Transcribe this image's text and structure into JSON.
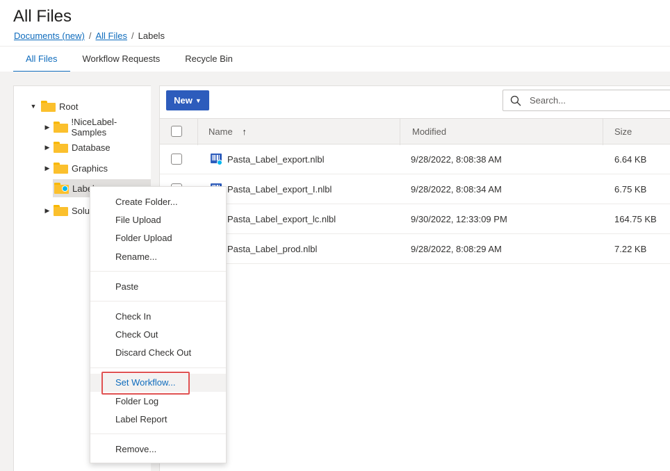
{
  "header": {
    "title": "All Files"
  },
  "breadcrumb": {
    "item1": "Documents (new)",
    "item2": "All Files",
    "current": "Labels",
    "separator": "/"
  },
  "tabs": [
    {
      "label": "All Files",
      "active": true
    },
    {
      "label": "Workflow Requests",
      "active": false
    },
    {
      "label": "Recycle Bin",
      "active": false
    }
  ],
  "tree": {
    "root": "Root",
    "items": [
      "!NiceLabel-Samples",
      "Database",
      "Graphics",
      "Labels",
      "Solutions"
    ]
  },
  "toolbar": {
    "new_label": "New",
    "search_placeholder": "Search..."
  },
  "grid": {
    "columns": {
      "name": "Name",
      "modified": "Modified",
      "size": "Size"
    },
    "rows": [
      {
        "name": "Pasta_Label_export.nlbl",
        "modified": "9/28/2022, 8:08:38 AM",
        "size": "6.64 KB"
      },
      {
        "name": "Pasta_Label_export_I.nlbl",
        "modified": "9/28/2022, 8:08:34 AM",
        "size": "6.75 KB"
      },
      {
        "name": "Pasta_Label_export_lc.nlbl",
        "modified": "9/30/2022, 12:33:09 PM",
        "size": "164.75 KB"
      },
      {
        "name": "Pasta_Label_prod.nlbl",
        "modified": "9/28/2022, 8:08:29 AM",
        "size": "7.22 KB"
      }
    ]
  },
  "context_menu": {
    "create_folder": "Create Folder...",
    "file_upload": "File Upload",
    "folder_upload": "Folder Upload",
    "rename": "Rename...",
    "paste": "Paste",
    "check_in": "Check In",
    "check_out": "Check Out",
    "discard_check_out": "Discard Check Out",
    "set_workflow": "Set Workflow...",
    "folder_log": "Folder Log",
    "label_report": "Label Report",
    "remove": "Remove..."
  },
  "colors": {
    "accent": "#0f6cbd",
    "primary_button": "#2d5cbc",
    "folder": "#fbc02d",
    "highlight_box": "#e05252",
    "status_dot": "#00b7f0"
  }
}
